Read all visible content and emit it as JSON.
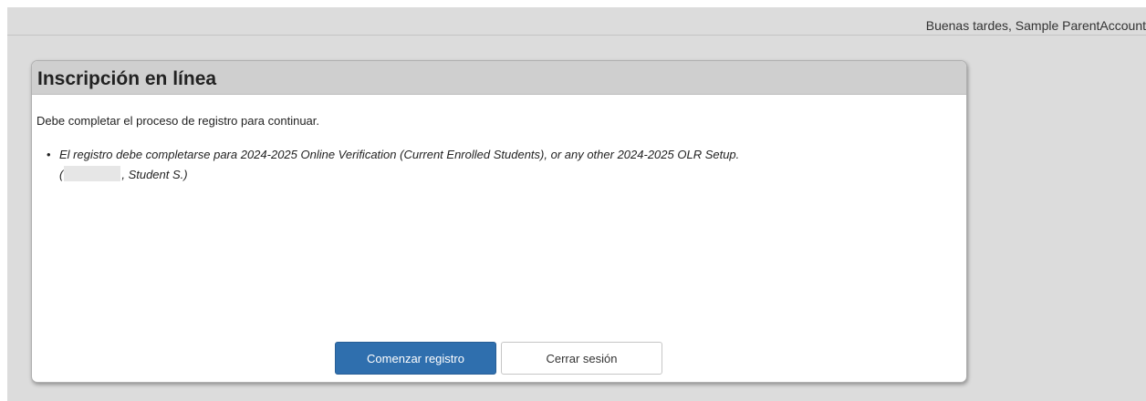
{
  "header": {
    "greeting": "Buenas tardes, Sample ParentAccount"
  },
  "card": {
    "title": "Inscripción en línea",
    "intro": "Debe completar el proceso de registro para continuar.",
    "items": [
      {
        "bullet": "•",
        "line1": "El registro debe completarse para 2024-2025 Online Verification (Current Enrolled Students), or any other 2024-2025 OLR Setup.",
        "open_paren": "(",
        "student": ", Student S.)"
      }
    ]
  },
  "actions": {
    "start_label": "Comenzar registro",
    "logout_label": "Cerrar sesión"
  },
  "colors": {
    "primary_button": "#2f6fae",
    "header_band": "#cfcfcf",
    "background": "#dcdcdc"
  }
}
